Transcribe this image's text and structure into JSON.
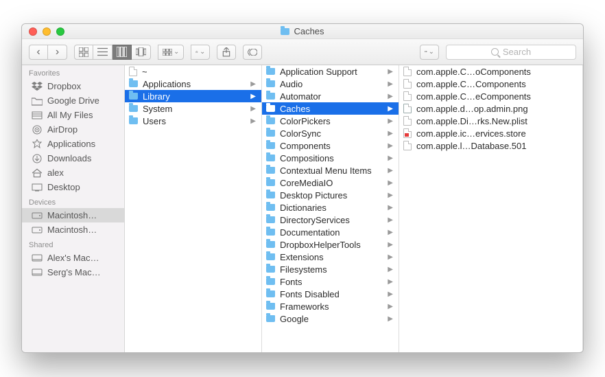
{
  "title": "Caches",
  "search_placeholder": "Search",
  "sidebar": {
    "sections": [
      {
        "label": "Favorites",
        "items": [
          {
            "icon": "dropbox",
            "label": "Dropbox"
          },
          {
            "icon": "folder",
            "label": "Google Drive"
          },
          {
            "icon": "allfiles",
            "label": "All My Files"
          },
          {
            "icon": "airdrop",
            "label": "AirDrop"
          },
          {
            "icon": "apps",
            "label": "Applications"
          },
          {
            "icon": "downloads",
            "label": "Downloads"
          },
          {
            "icon": "home",
            "label": "alex"
          },
          {
            "icon": "desktop",
            "label": "Desktop"
          }
        ]
      },
      {
        "label": "Devices",
        "items": [
          {
            "icon": "disk",
            "label": "Macintosh…",
            "selected": true
          },
          {
            "icon": "disk",
            "label": "Macintosh…"
          }
        ]
      },
      {
        "label": "Shared",
        "items": [
          {
            "icon": "server",
            "label": "Alex's Mac…"
          },
          {
            "icon": "server",
            "label": "Serg's Mac…"
          }
        ]
      }
    ]
  },
  "col1": [
    {
      "icon": "page",
      "label": "~",
      "arrow": false
    },
    {
      "icon": "drivefolder",
      "label": "Applications",
      "arrow": true
    },
    {
      "icon": "drivefolder",
      "label": "Library",
      "arrow": true,
      "selected": true
    },
    {
      "icon": "drivefolder",
      "label": "System",
      "arrow": true
    },
    {
      "icon": "drivefolder",
      "label": "Users",
      "arrow": true
    }
  ],
  "col2": [
    {
      "label": "Application Support"
    },
    {
      "label": "Audio"
    },
    {
      "label": "Automator"
    },
    {
      "label": "Caches",
      "selected": true
    },
    {
      "label": "ColorPickers"
    },
    {
      "label": "ColorSync"
    },
    {
      "label": "Components"
    },
    {
      "label": "Compositions"
    },
    {
      "label": "Contextual Menu Items"
    },
    {
      "label": "CoreMediaIO"
    },
    {
      "label": "Desktop Pictures"
    },
    {
      "label": "Dictionaries"
    },
    {
      "label": "DirectoryServices"
    },
    {
      "label": "Documentation"
    },
    {
      "label": "DropboxHelperTools"
    },
    {
      "label": "Extensions"
    },
    {
      "label": "Filesystems"
    },
    {
      "label": "Fonts"
    },
    {
      "label": "Fonts Disabled"
    },
    {
      "label": "Frameworks"
    },
    {
      "label": "Google"
    }
  ],
  "col3": [
    {
      "icon": "page",
      "label": "com.apple.C…oComponents"
    },
    {
      "icon": "page",
      "label": "com.apple.C…Components"
    },
    {
      "icon": "page",
      "label": "com.apple.C…eComponents"
    },
    {
      "icon": "png",
      "label": "com.apple.d…op.admin.png"
    },
    {
      "icon": "page",
      "label": "com.apple.Di…rks.New.plist"
    },
    {
      "icon": "red",
      "label": "com.apple.ic…ervices.store"
    },
    {
      "icon": "page",
      "label": "com.apple.l…Database.501"
    }
  ]
}
